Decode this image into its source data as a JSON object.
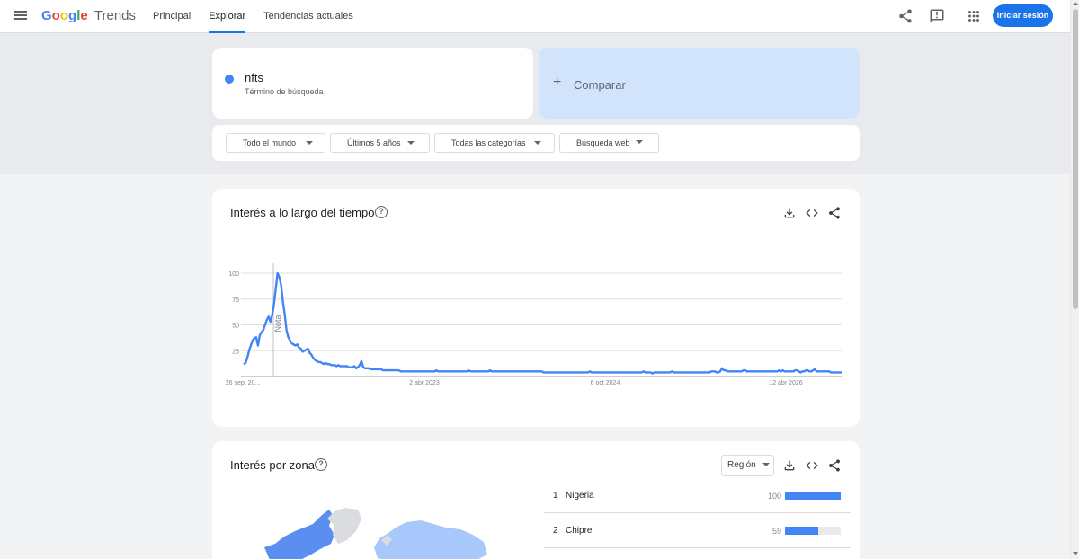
{
  "header": {
    "logo_google": "Google",
    "logo_trends": "Trends",
    "nav": [
      "Principal",
      "Explorar",
      "Tendencias actuales"
    ],
    "active_nav": 1,
    "signin_label": "Iniciar sesión"
  },
  "search": {
    "term": "nfts",
    "term_type": "Término de búsqueda",
    "term_color": "#4285f4",
    "compare_label": "Comparar"
  },
  "filters": {
    "region": "Todo el mundo",
    "period": "Últimos 5 años",
    "category": "Todas las categorías",
    "property": "Búsqueda web"
  },
  "interest_over_time": {
    "title": "Interés a lo largo del tiempo",
    "note_label": "Nota"
  },
  "chart_data": {
    "type": "line",
    "title": "Interés a lo largo del tiempo",
    "x_tick_labels": [
      "26 sept 20...",
      "2 abr 2023",
      "6 oct 2024",
      "12 abr 2026"
    ],
    "y_tick_labels": [
      "100",
      "75",
      "50",
      "25"
    ],
    "ylim": [
      0,
      100
    ],
    "grid": true,
    "series": [
      {
        "name": "nfts",
        "color": "#4285f4",
        "values": [
          12,
          13,
          18,
          25,
          30,
          35,
          37,
          38,
          30,
          40,
          43,
          45,
          50,
          55,
          58,
          53,
          60,
          70,
          85,
          100,
          96,
          88,
          72,
          60,
          45,
          38,
          35,
          32,
          31,
          30,
          31,
          28,
          27,
          24,
          25,
          26,
          27,
          23,
          21,
          18,
          16,
          15,
          14,
          14,
          13,
          12,
          13,
          12,
          12,
          11,
          11,
          11,
          10,
          11,
          10,
          10,
          10,
          10,
          10,
          9,
          9,
          9,
          10,
          8,
          9,
          11,
          15,
          9,
          8,
          8,
          8,
          7,
          7,
          7,
          7,
          7,
          7,
          7,
          6,
          6,
          6,
          6,
          6,
          6,
          6,
          6,
          6,
          6,
          5,
          5,
          5,
          5,
          5,
          5,
          5,
          5,
          5,
          5,
          5,
          5,
          5,
          5,
          5,
          5,
          5,
          5,
          5,
          5,
          6,
          5,
          5,
          5,
          5,
          5,
          5,
          5,
          5,
          5,
          5,
          5,
          5,
          5,
          5,
          5,
          5,
          5,
          6,
          5,
          5,
          5,
          5,
          5,
          5,
          5,
          5,
          5,
          5,
          5,
          6,
          5,
          5,
          5,
          5,
          5,
          5,
          5,
          5,
          5,
          5,
          5,
          5,
          5,
          5,
          5,
          5,
          5,
          5,
          5,
          5,
          5,
          5,
          5,
          5,
          5,
          5,
          5,
          5,
          5,
          4,
          4,
          4,
          4,
          4,
          4,
          4,
          4,
          4,
          4,
          4,
          4,
          4,
          4,
          4,
          4,
          4,
          4,
          4,
          4,
          4,
          4,
          4,
          4,
          4,
          4,
          5,
          4,
          4,
          4,
          4,
          4,
          4,
          4,
          4,
          4,
          4,
          4,
          4,
          4,
          4,
          4,
          4,
          4,
          4,
          4,
          4,
          4,
          4,
          4,
          4,
          4,
          4,
          4,
          4,
          4,
          5,
          4,
          4,
          4,
          4,
          3,
          4,
          4,
          4,
          4,
          4,
          4,
          4,
          4,
          4,
          4,
          5,
          4,
          4,
          4,
          4,
          4,
          4,
          4,
          4,
          4,
          4,
          4,
          4,
          4,
          4,
          4,
          4,
          4,
          4,
          4,
          4,
          4,
          5,
          5,
          5,
          4,
          4,
          5,
          8,
          6,
          6,
          5,
          5,
          5,
          5,
          5,
          5,
          5,
          5,
          5,
          6,
          6,
          5,
          5,
          5,
          5,
          5,
          5,
          5,
          5,
          5,
          5,
          5,
          5,
          5,
          5,
          5,
          5,
          5,
          5,
          6,
          5,
          6,
          5,
          5,
          5,
          5,
          5,
          5,
          6,
          6,
          5,
          4,
          5,
          5,
          6,
          6,
          5,
          5,
          6,
          7,
          5,
          5,
          5,
          5,
          5,
          5,
          5,
          5,
          4,
          4,
          4,
          4,
          4,
          4,
          4
        ]
      }
    ]
  },
  "interest_by_region": {
    "title": "Interés por zona",
    "resolution_label": "Región",
    "rows": [
      {
        "rank": "1",
        "name": "Nigeria",
        "value": "100",
        "fraction": 1.0
      },
      {
        "rank": "2",
        "name": "Chipre",
        "value": "59",
        "fraction": 0.59
      }
    ]
  }
}
